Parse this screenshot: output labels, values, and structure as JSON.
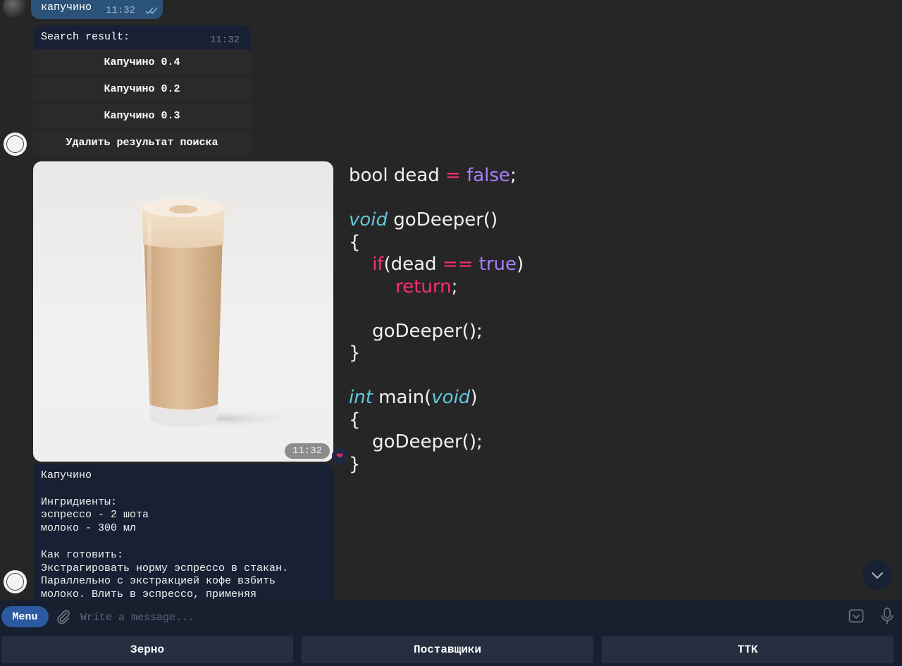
{
  "outgoing": {
    "text": "капучино",
    "time": "11:32",
    "status": "read"
  },
  "search": {
    "title": "Search result:",
    "time": "11:32",
    "buttons": [
      "Капучино 0.4",
      "Капучино 0.2",
      "Капучино 0.3",
      "Удалить результат поиска"
    ]
  },
  "photo": {
    "time": "11:32",
    "reaction": "❤"
  },
  "description": {
    "text": "Капучино\n\nИнгридиенты:\nэспрессо - 2 шота\nмолоко - 300 мл\n\nКак готовить:\nЭкстрагировать норму эспрессо в стакан.\nПараллельно с экстракцией кофе взбить\nмолоко. Влить в эспрессо, применяя"
  },
  "code": {
    "l1_a": "bool dead ",
    "l1_op": "=",
    "l1_val": "false",
    "l1_end": ";",
    "l3_type": "void",
    "l3_rest": " goDeeper()",
    "brace_open": "{",
    "brace_close": "}",
    "l5_if": "if",
    "l5_a": "(dead ",
    "l5_op": "==",
    "l5_val": "true",
    "l5_end": ")",
    "l6_ret": "return",
    "l6_end": ";",
    "call": "goDeeper();",
    "l11_type": "int",
    "l11_mid": " main(",
    "l11_void": "void",
    "l11_end": ")"
  },
  "composer": {
    "menu_label": "Menu",
    "placeholder": "Write a message..."
  },
  "bottom_keyboard": [
    "Зерно",
    "Поставщики",
    "ТТК"
  ],
  "colors": {
    "background": "#262626",
    "bubble": "#182033",
    "outgoing_bubble": "#2b5278",
    "accent": "#2b5aa0"
  },
  "icons": [
    "double-check-icon",
    "heart-icon",
    "paperclip-icon",
    "keyboard-icon",
    "microphone-icon",
    "chevron-down-icon",
    "bot-avatar-logo"
  ]
}
